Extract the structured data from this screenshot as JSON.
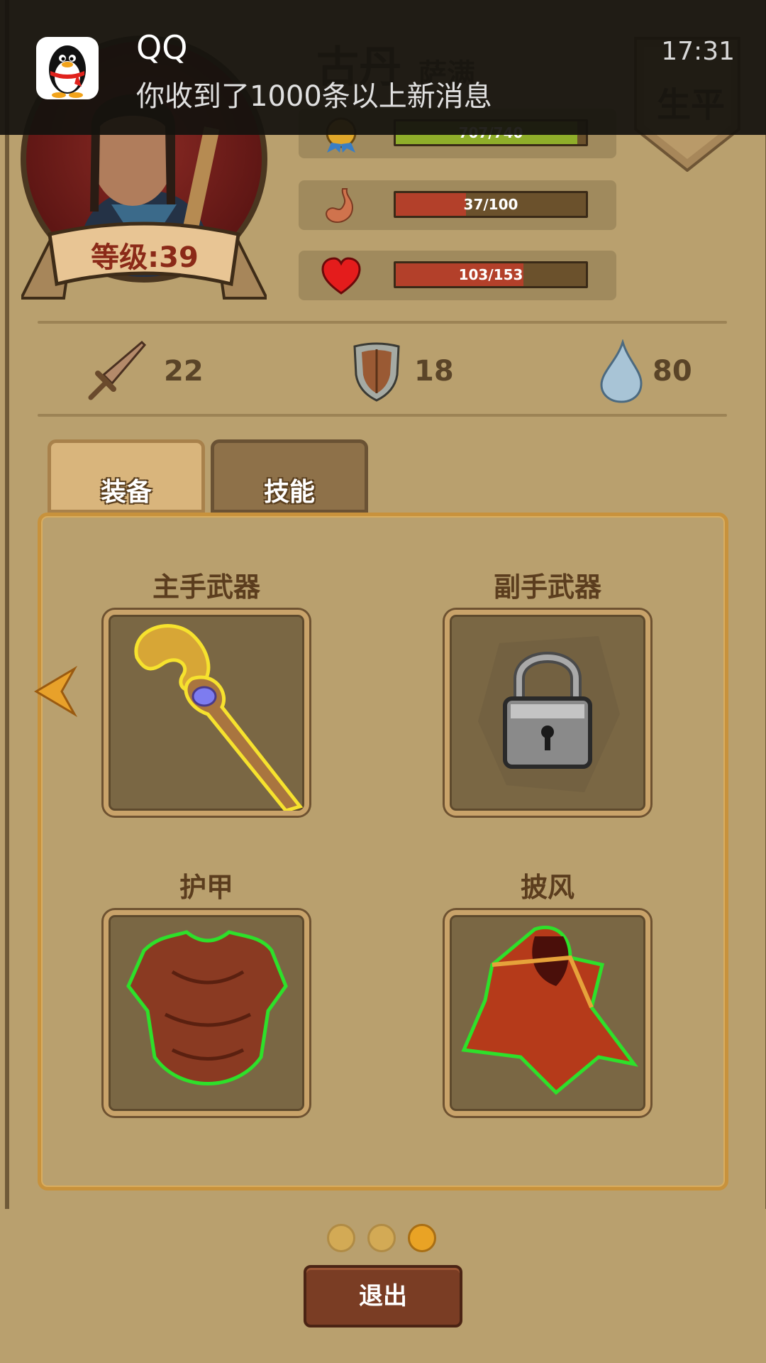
{
  "notification": {
    "app": "QQ",
    "message": "你收到了1000条以上新消息",
    "time": "17:31",
    "icon": "qq-penguin-icon"
  },
  "hero": {
    "name": "古丹",
    "subtitle": "萨满",
    "level_label": "等级:39",
    "bio_tab": "生平"
  },
  "stats": {
    "experience": {
      "text": "707/740",
      "fraction": 0.955,
      "icon": "badge-icon",
      "color": "#8fae2a"
    },
    "hunger": {
      "text": "37/100",
      "fraction": 0.37,
      "icon": "stomach-icon",
      "color": "#b3402a"
    },
    "health": {
      "text": "103/153",
      "fraction": 0.673,
      "icon": "heart-icon",
      "color": "#b3402a"
    }
  },
  "attributes": {
    "attack": {
      "value": "22",
      "icon": "sword-icon"
    },
    "defense": {
      "value": "18",
      "icon": "shield-icon"
    },
    "water": {
      "value": "80",
      "icon": "water-drop-icon"
    }
  },
  "tabs": {
    "equipment": "装备",
    "skills": "技能",
    "active": "equipment"
  },
  "slots": {
    "main_weapon": {
      "title": "主手武器",
      "item": "staff-icon"
    },
    "off_weapon": {
      "title": "副手武器",
      "item": "lock-icon"
    },
    "armor": {
      "title": "护甲",
      "item": "chest-armor-icon"
    },
    "cloak": {
      "title": "披风",
      "item": "cloak-icon"
    }
  },
  "pager": {
    "count": 3,
    "active": 3
  },
  "exit_label": "退出"
}
